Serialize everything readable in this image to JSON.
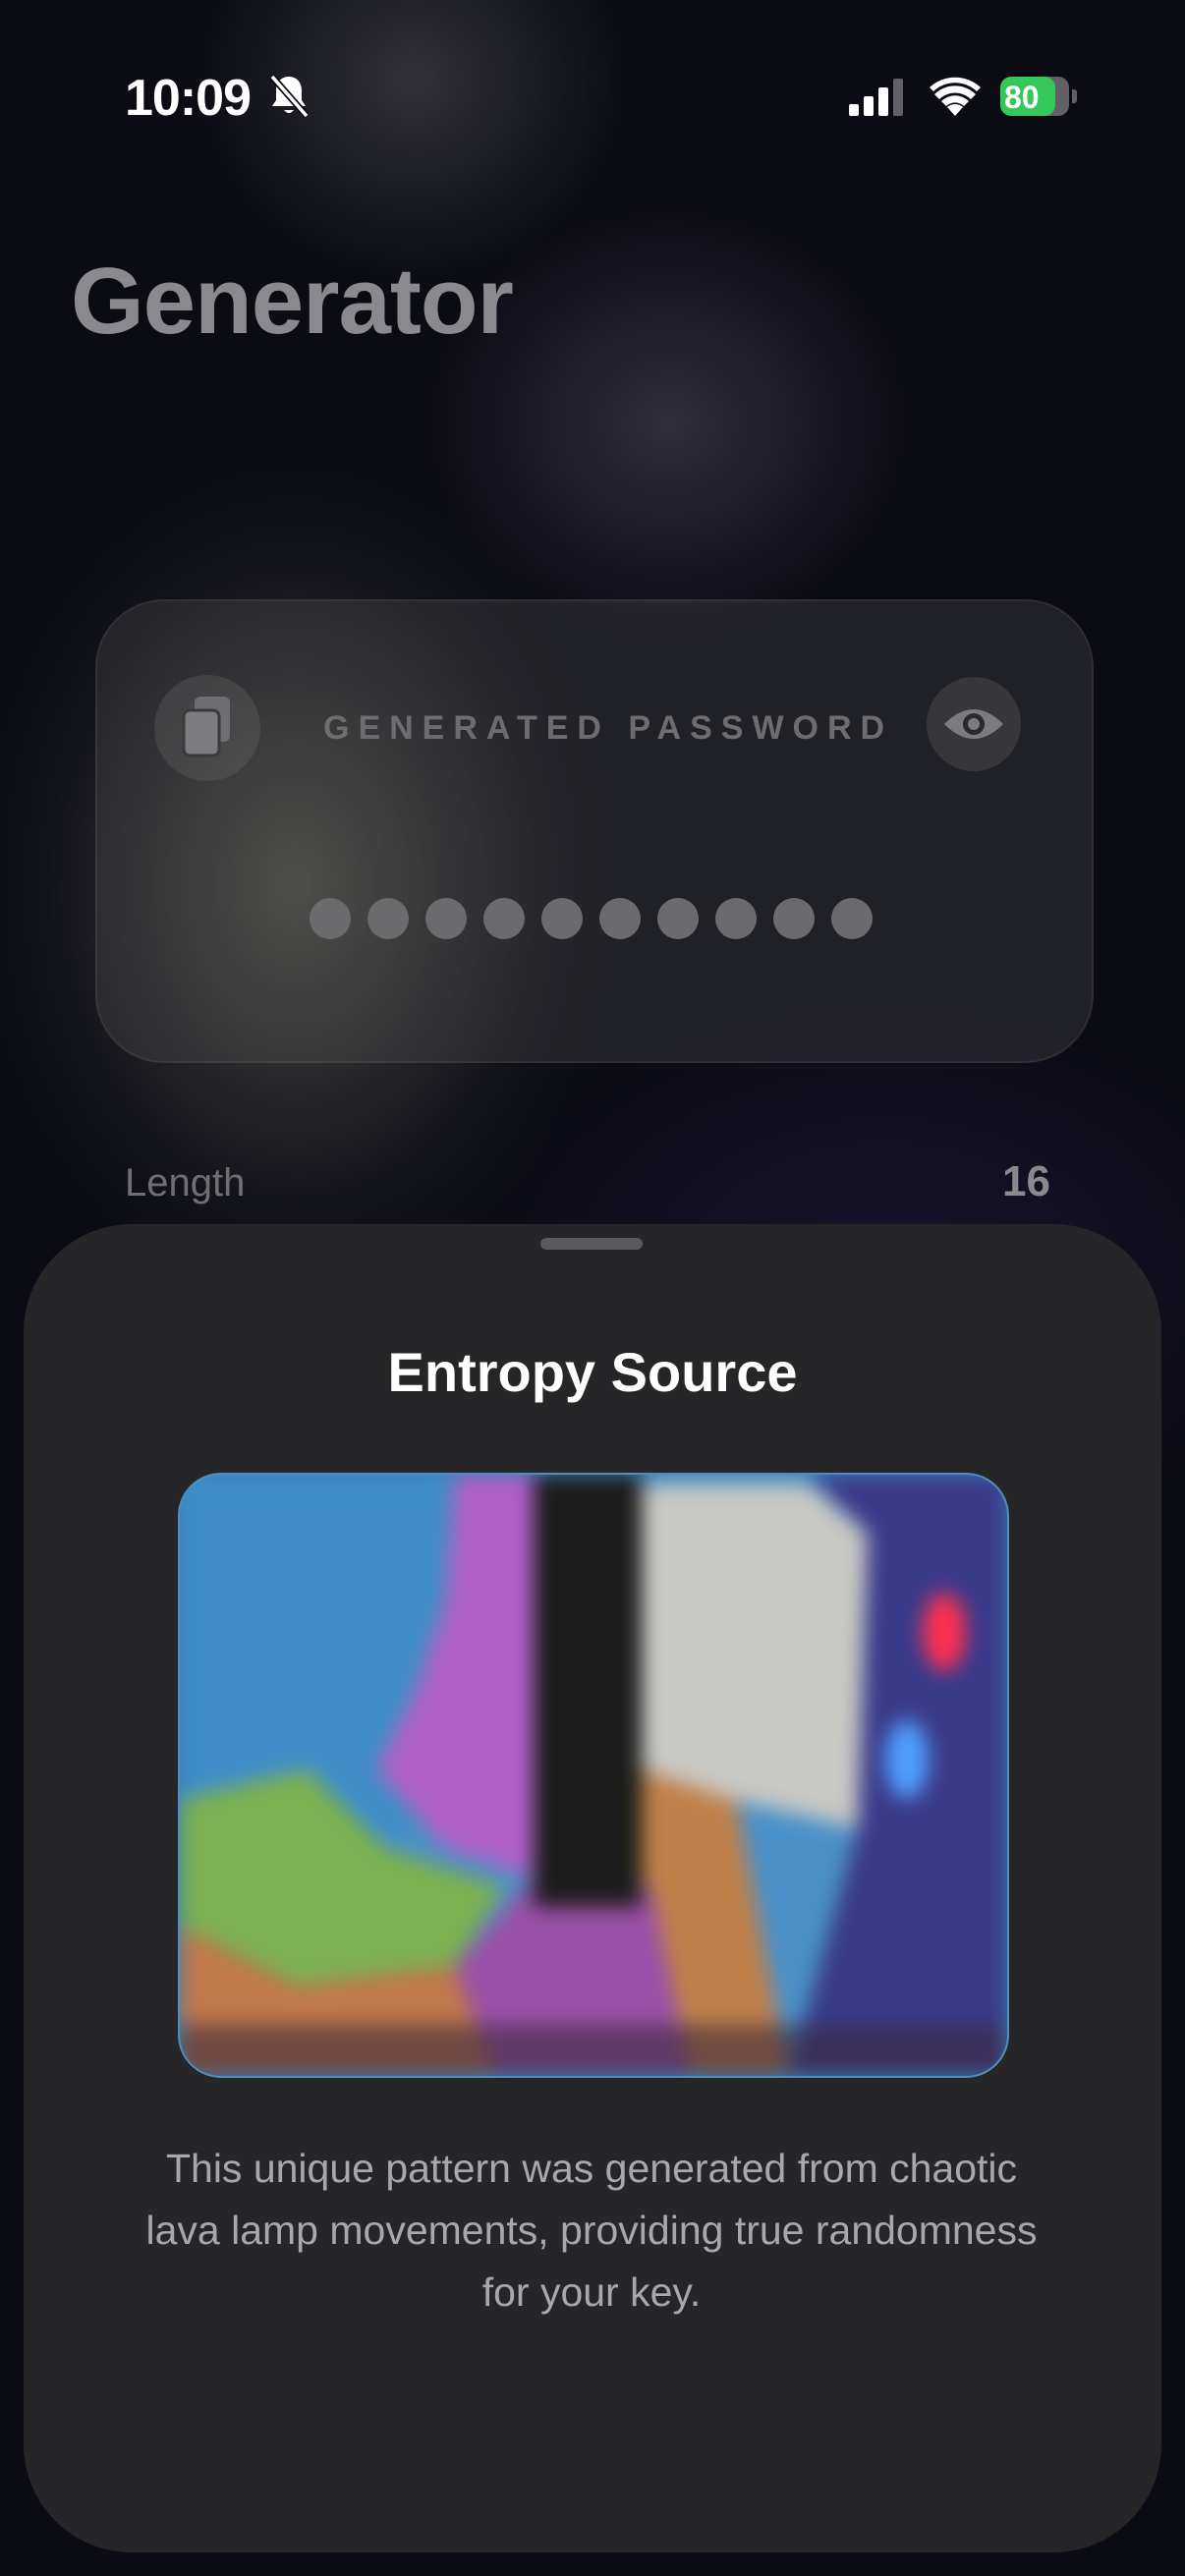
{
  "status": {
    "time": "10:09",
    "battery": "80",
    "battery_level": 0.8
  },
  "header": {
    "title": "Generator"
  },
  "password_card": {
    "label": "GENERATED PASSWORD",
    "masked_dot_count": 10
  },
  "length": {
    "label": "Length",
    "value": "16"
  },
  "sheet": {
    "title": "Entropy Source",
    "description": "This unique pattern was generated from chaotic lava lamp movements, providing true randomness for your key."
  },
  "icons": {
    "bell": "bell-slash-icon",
    "copy": "copy-icon",
    "eye": "eye-icon",
    "signal": "cellular-signal-icon",
    "wifi": "wifi-icon",
    "battery": "battery-charging-icon"
  },
  "colors": {
    "battery_green": "#34c759",
    "sheet_bg": "#262628"
  }
}
